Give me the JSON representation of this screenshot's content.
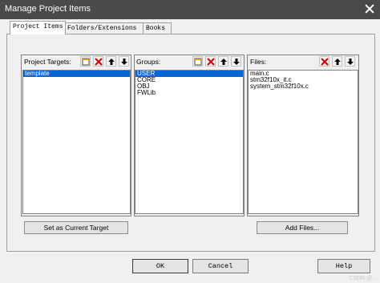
{
  "window": {
    "title": "Manage Project Items"
  },
  "tabs": [
    "Project Items",
    "Folders/Extensions",
    "Books"
  ],
  "targets": {
    "label": "Project Targets:",
    "items": [
      "template"
    ],
    "selected": 0
  },
  "groups": {
    "label": "Groups:",
    "items": [
      "USER",
      "CORE",
      "OBJ",
      "FWLib"
    ],
    "selected": 0
  },
  "files": {
    "label": "Files:",
    "items": [
      "main.c",
      "stm32f10x_it.c",
      "system_stm32f10x.c"
    ]
  },
  "buttons": {
    "set_target": "Set as Current Target",
    "add_files": "Add Files...",
    "ok": "OK",
    "cancel": "Cancel",
    "help": "Help"
  },
  "colors": {
    "selection": "#0a64d6",
    "titlebar": "#4a4a4a",
    "delete": "#cc0000"
  },
  "watermark": "CSDN @..."
}
